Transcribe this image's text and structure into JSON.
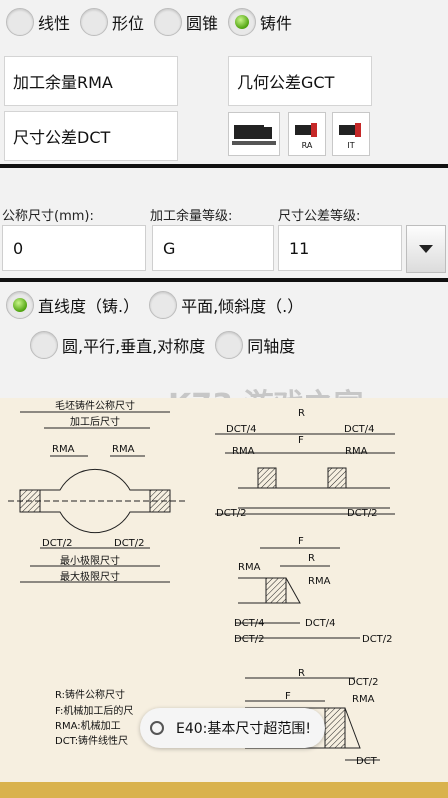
{
  "tabs": [
    {
      "label": "线性",
      "selected": false
    },
    {
      "label": "形位",
      "selected": false
    },
    {
      "label": "圆锥",
      "selected": false
    },
    {
      "label": "铸件",
      "selected": true
    }
  ],
  "buttons": {
    "machining_allowance": "加工余量RMA",
    "geometric_tolerance": "几何公差GCT",
    "dimensional_tolerance": "尺寸公差DCT",
    "icon_ra": "RA",
    "icon_it": "IT"
  },
  "form": {
    "nominal_label": "公称尺寸(mm):",
    "nominal_value": "0",
    "allowance_grade_label": "加工余量等级:",
    "allowance_grade_value": "G",
    "tolerance_grade_label": "尺寸公差等级:",
    "tolerance_grade_value": "11"
  },
  "tolerance_types": [
    {
      "label": "直线度（铸.）",
      "selected": true
    },
    {
      "label": "平面,倾斜度（.）",
      "selected": false
    },
    {
      "label": "圆,平行,垂直,对称度",
      "selected": false
    },
    {
      "label": "同轴度",
      "selected": false
    }
  ],
  "diagram": {
    "blank_nominal": "毛坯铸件公称尺寸",
    "after_machining": "加工后尺寸",
    "rma": "RMA",
    "dct2": "DCT/2",
    "dct4": "DCT/4",
    "min_limit": "最小极限尺寸",
    "max_limit": "最大极限尺寸",
    "r": "R",
    "f": "F",
    "dct": "DCT",
    "legend": [
      "R:铸件公称尺寸",
      "F:机械加工后的尺",
      "RMA:机械加工",
      "DCT:铸件线性尺"
    ]
  },
  "watermark": "K73 游戏之家",
  "toast": "E40:基本尺寸超范围!"
}
